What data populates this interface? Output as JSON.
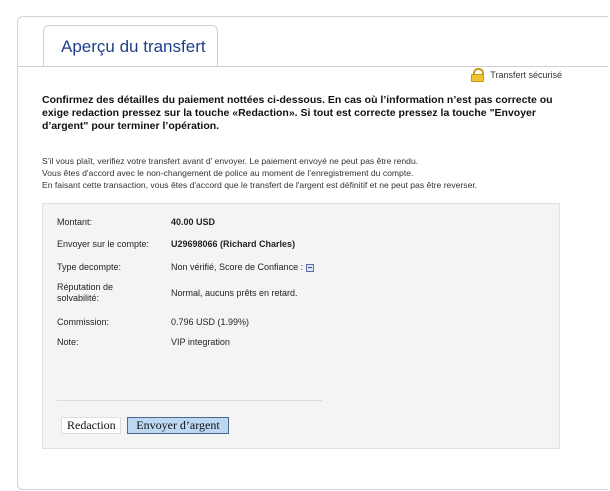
{
  "header": {
    "title": "Aperçu du transfert"
  },
  "secure_badge": {
    "icon": "lock-icon",
    "label": "Transfert sécurisé"
  },
  "confirm_text": "Confirmez des détailles du paiement nottées ci-dessous. En cas où l’information n’est pas correcte ou exige redaction pressez sur la touche «Redaction». Si tout est correcte pressez la touche \"Envoyer d’argent\" pour terminer l’opération.",
  "notice": [
    "S’il vous plaît, verifiez votre transfert avant d’ envoyer. Le paiement envoyé ne peut pas être rendu.",
    "Vous êtes d'accord avec le non-changement de police au moment de l’enregistrement du compte.",
    "En faisant cette transaction, vous êtes d'accord que le transfert de l'argent est définitif et ne peut pas être reverser."
  ],
  "details": [
    {
      "label": "Montant:",
      "value": "40.00 USD"
    },
    {
      "label": "Envoyer sur le compte:",
      "value": "U29698066 (Richard Charles)"
    },
    {
      "label": "Type decompte:",
      "value": "Non vérifié, Score de Confiance :"
    },
    {
      "label": "Réputation de solvabilité:",
      "value": "Normal, aucuns prêts en retard."
    },
    {
      "label": "Commission:",
      "value": "0.796 USD (1.99%)"
    },
    {
      "label": "Note:",
      "value": "VIP integration"
    }
  ],
  "buttons": {
    "redaction": "Redaction",
    "send": "Envoyer d’argent"
  },
  "colors": {
    "title": "#1e3f8a",
    "send_button_bg": "#bcd8f3",
    "panel_bg": "#f4f4f4"
  }
}
